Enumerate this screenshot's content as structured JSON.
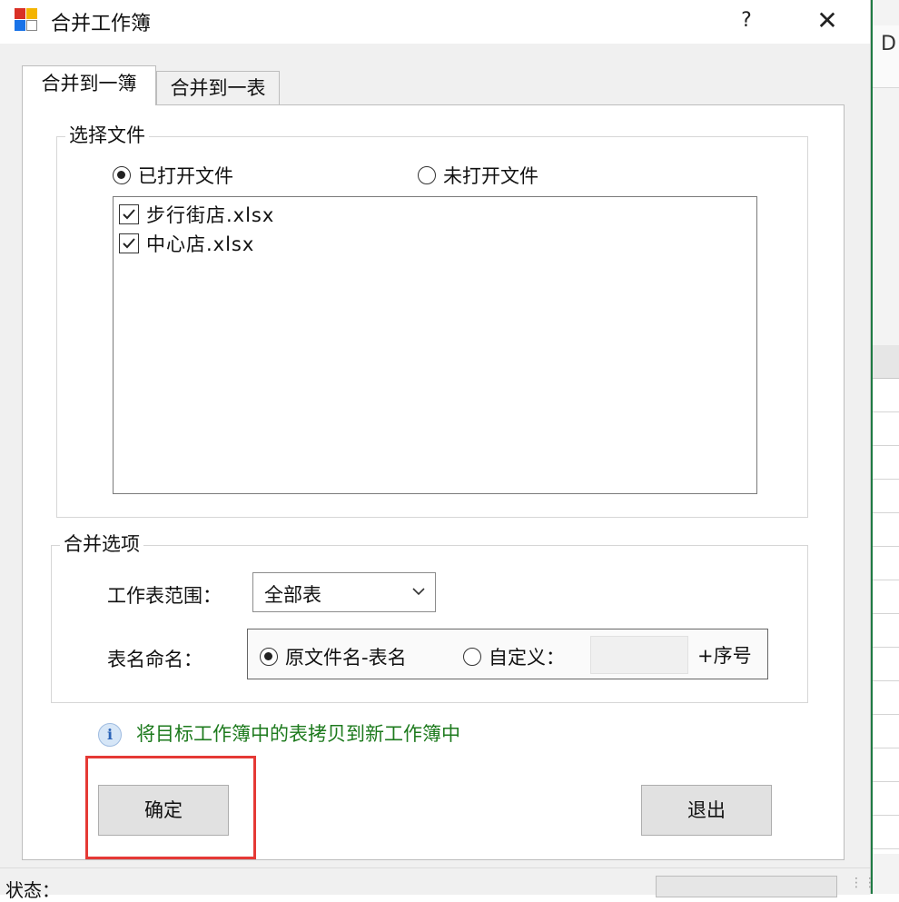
{
  "window": {
    "title": "合并工作簿",
    "help": "?",
    "close": "✕"
  },
  "tabs": [
    {
      "label": "合并到一簿",
      "active": true
    },
    {
      "label": "合并到一表",
      "active": false
    }
  ],
  "select_files": {
    "legend": "选择文件",
    "radio_opened": {
      "label": "已打开文件",
      "selected": true
    },
    "radio_unopened": {
      "label": "未打开文件",
      "selected": false
    },
    "files": [
      {
        "name": "步行街店.xlsx",
        "checked": true
      },
      {
        "name": "中心店.xlsx",
        "checked": true
      }
    ]
  },
  "merge_options": {
    "legend": "合并选项",
    "range_label": "工作表范围：",
    "range_value": "全部表",
    "naming_label": "表名命名：",
    "naming_original": {
      "label": "原文件名-表名",
      "selected": true
    },
    "naming_custom": {
      "label": "自定义：",
      "selected": false
    },
    "custom_value": "",
    "suffix": "+序号"
  },
  "info": {
    "text": "将目标工作簿中的表拷贝到新工作簿中"
  },
  "buttons": {
    "ok": "确定",
    "exit": "退出"
  },
  "status": {
    "label": "状态："
  },
  "background": {
    "ribbon_text": "D"
  },
  "colors": {
    "info_text": "#1d7a1d",
    "highlight": "#e53935",
    "excel_green": "#1f7a43"
  }
}
